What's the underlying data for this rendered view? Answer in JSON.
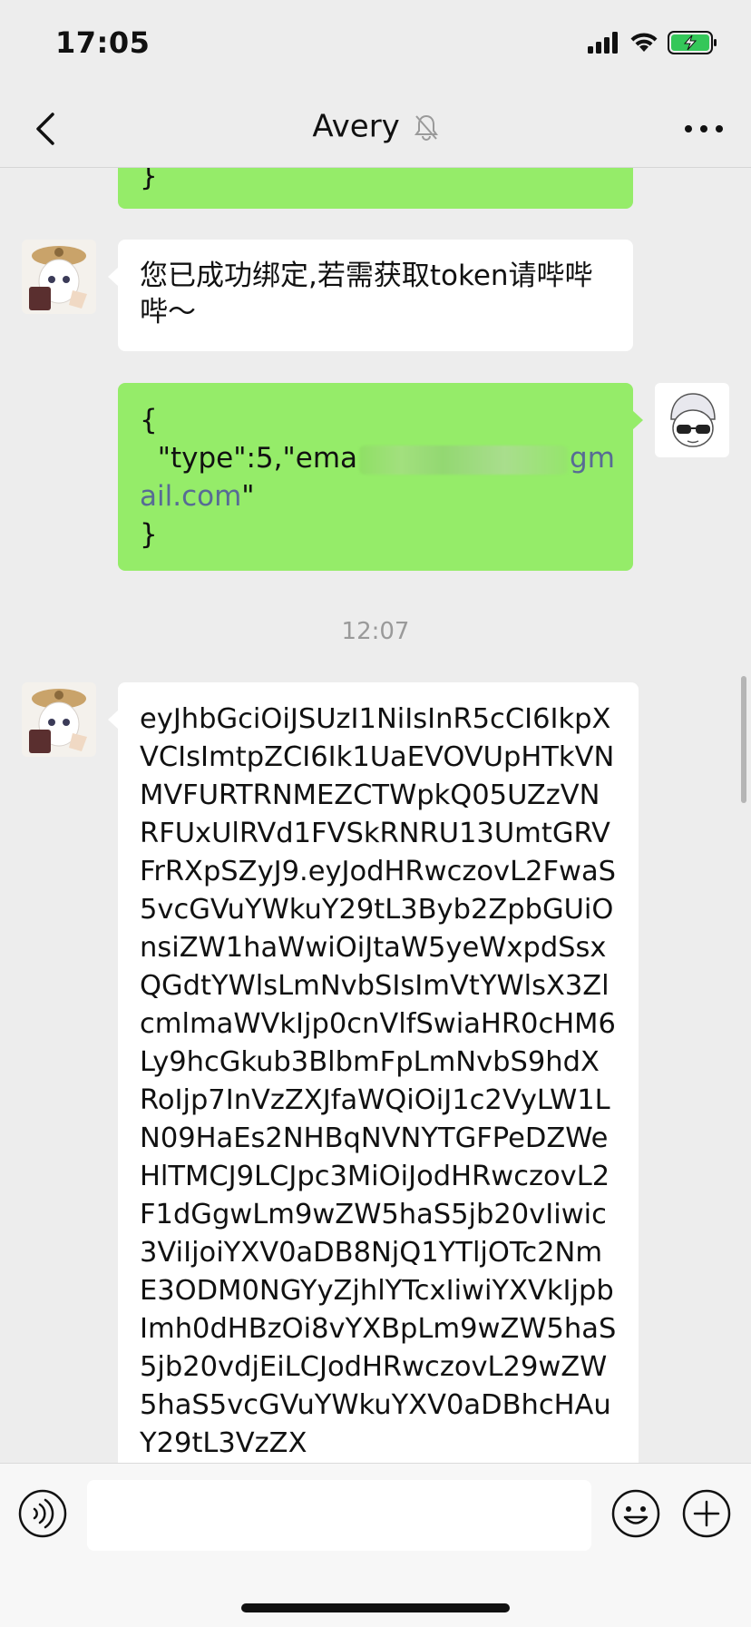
{
  "status_bar": {
    "time": "17:05"
  },
  "nav": {
    "title": "Avery",
    "muted": true
  },
  "messages": {
    "m0_text": "}",
    "m1_text": "您已成功绑定,若需获取token请哔哔哔～",
    "m2_line1": "{",
    "m2_line2_prefix": "  \"type\":5,\"ema",
    "m2_line2_link": "gm",
    "m2_line3_link": "ail.com",
    "m2_line3_suffix": "\"",
    "m2_line4": "}",
    "timestamp": "12:07",
    "m3_text": "eyJhbGciOiJSUzI1NiIsInR5cCI6IkpXVCIsImtpZCI6Ik1UaEVOVUpHTkVNMVFURTRNMEZCTWpkQ05UZzVNRFUxUlRVd1FVSkRNRU13UmtGRVFrRXpSZyJ9.eyJodHRwczovL2FwaS5vcGVuYWkuY29tL3Byb2ZpbGUiOnsiZW1haWwiOiJtaW5yeWxpdSsxQGdtYWlsLmNvbSIsImVtYWlsX3ZlcmlmaWVkIjp0cnVlfSwiaHR0cHM6Ly9hcGkub3BlbmFpLmNvbS9hdXRoIjp7InVzZXJfaWQiOiJ1c2VyLW1LN09HaEs2NHBqNVNYTGFPeDZWeHlTMCJ9LCJpc3MiOiJodHRwczovL2F1dGgwLm9wZW5haS5jb20vIiwic3ViIjoiYXV0aDB8NjQ1YTljOTc2NmE3ODM0NGYyZjhlYTcxIiwiYXVkIjpbImh0dHBzOi8vYXBpLm9wZW5haS5jb20vdjEiLCJodHRwczovL29wZW5haS5vcGVuYWkuYXV0aDBhcHAuY29tL3VzZX"
  },
  "icons": {
    "back": "chevron-left-icon",
    "mute": "bell-off-icon",
    "more": "more-horizontal-icon",
    "voice": "voice-icon",
    "emoji": "emoji-icon",
    "plus": "plus-circle-icon"
  },
  "colors": {
    "background": "#ededed",
    "sent_bubble": "#95ec69",
    "received_bubble": "#ffffff",
    "link": "#576b95",
    "battery": "#34c759"
  }
}
